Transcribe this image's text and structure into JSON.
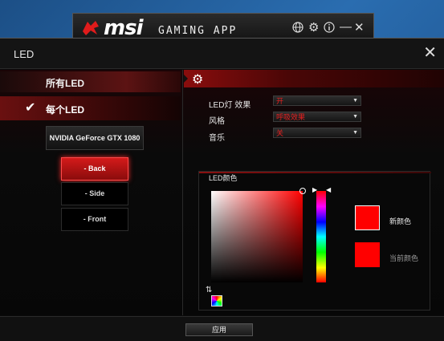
{
  "bg_app": {
    "logo": "msi",
    "subtitle": "GAMING APP",
    "globe_icon": "globe-icon",
    "settings_icon": "gear-icon",
    "info_icon": "info-icon",
    "minimize": "—",
    "close": "✕"
  },
  "window": {
    "title": "LED",
    "close_label": "✕"
  },
  "sidebar": {
    "all_led": "所有LED",
    "each_led": "每个LED",
    "check_mark": "✔",
    "gpu": "NVIDIA GeForce GTX 1080",
    "zones": [
      {
        "label": "- Back",
        "active": true
      },
      {
        "label": "- Side",
        "active": false
      },
      {
        "label": "- Front",
        "active": false
      }
    ]
  },
  "settings": {
    "gear": "⚙",
    "effect_label": "LED灯 效果",
    "effect_value": "开",
    "style_label": "风格",
    "style_value": "呼吸效果",
    "music_label": "音乐",
    "music_value": "关",
    "dropdown_arrow": "▼"
  },
  "color_panel": {
    "title": "LED颜色",
    "new_color_label": "新颜色",
    "current_color_label": "当前颜色",
    "new_color": "#ff0000",
    "current_color": "#ff0000",
    "reset_icon": "⇅"
  },
  "footer": {
    "apply": "应用"
  },
  "colors": {
    "accent": "#d41a1a",
    "value_red": "#e62020"
  }
}
